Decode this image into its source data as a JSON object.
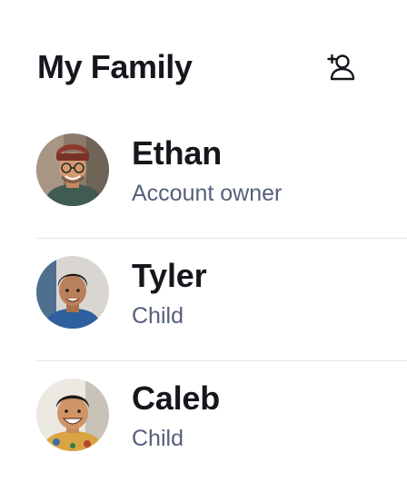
{
  "header": {
    "title": "My Family",
    "add_member_icon": "add-person-icon"
  },
  "members": [
    {
      "name": "Ethan",
      "role": "Account owner"
    },
    {
      "name": "Tyler",
      "role": "Child"
    },
    {
      "name": "Caleb",
      "role": "Child"
    }
  ],
  "colors": {
    "text_primary": "#16161d",
    "text_secondary": "#55607a",
    "divider": "#e3e6ec"
  }
}
